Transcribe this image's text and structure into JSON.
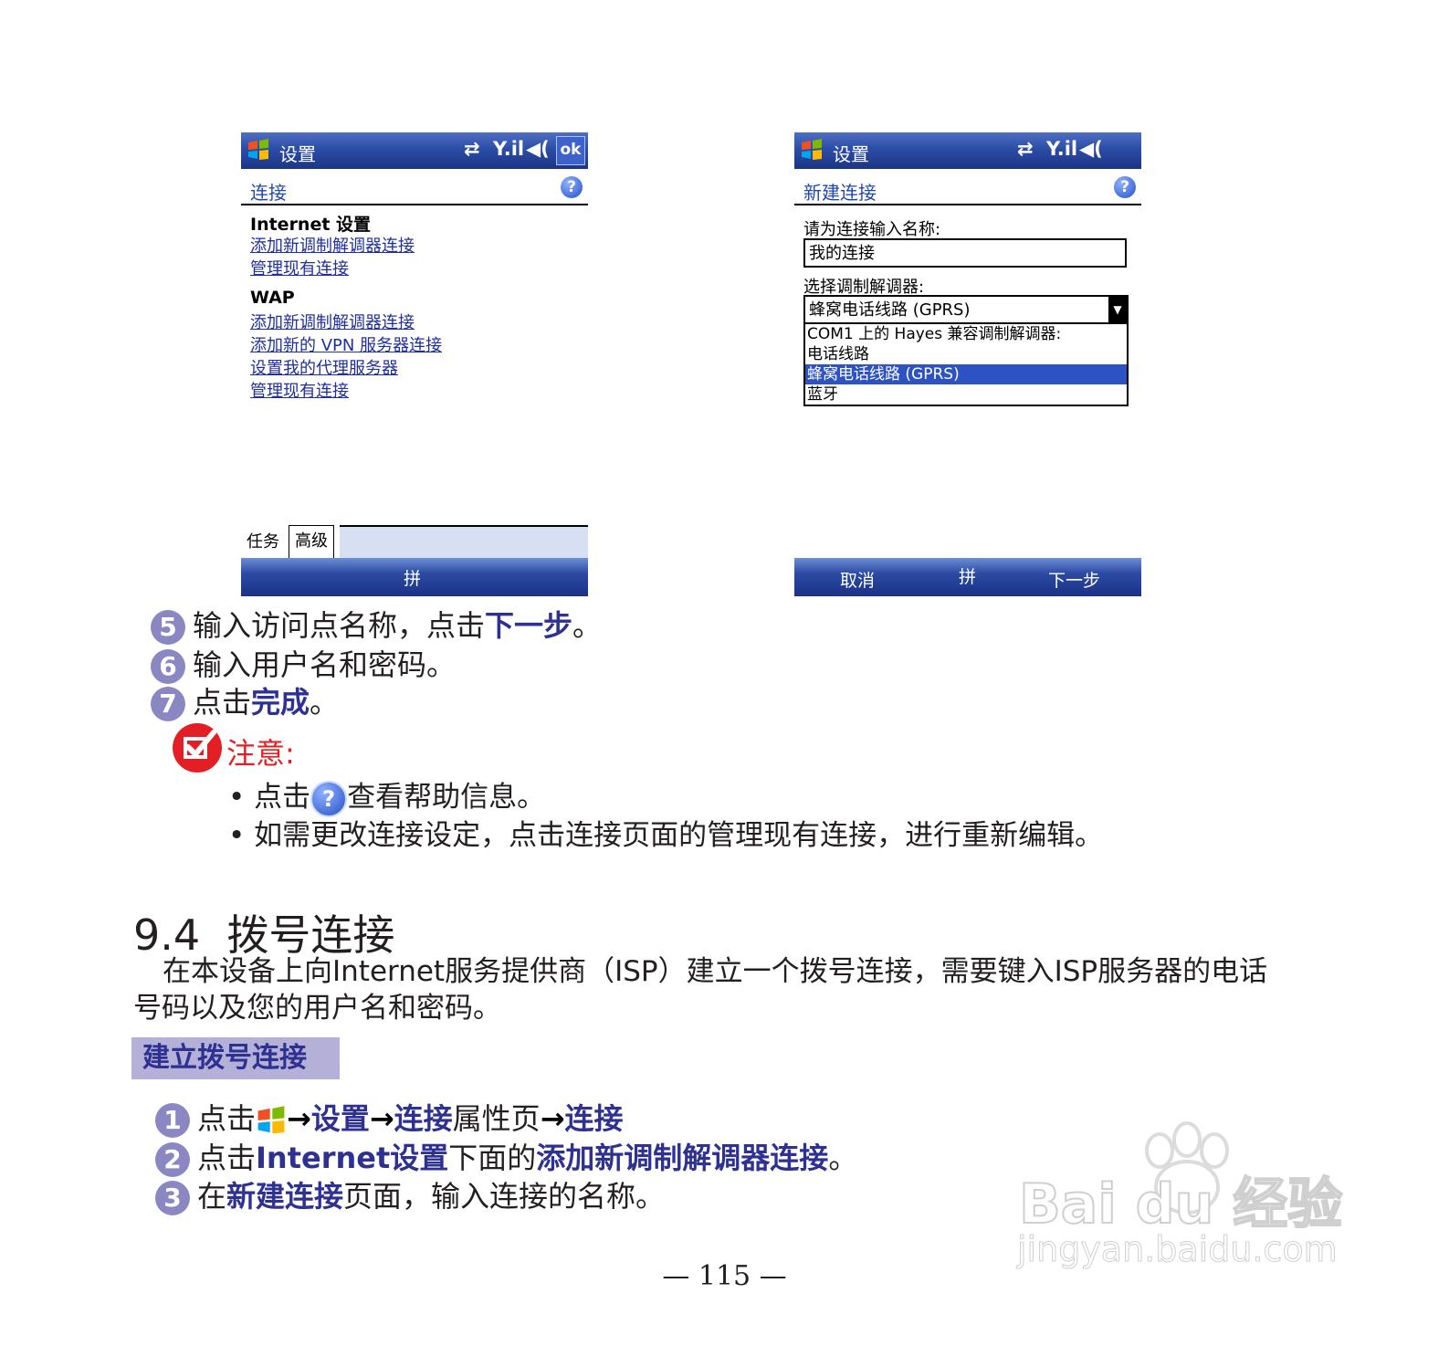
{
  "left_screen": {
    "title": "设置",
    "ok_label": "ok",
    "subheader": "连接",
    "help_glyph": "?",
    "sections": [
      {
        "heading": "Internet 设置",
        "links": [
          "添加新调制解调器连接",
          "管理现有连接"
        ]
      },
      {
        "heading": "WAP",
        "links": [
          "添加新调制解调器连接",
          "添加新的 VPN 服务器连接",
          "设置我的代理服务器",
          "管理现有连接"
        ]
      }
    ],
    "tabs": [
      "任务",
      "高级"
    ],
    "softbar_center": "拼"
  },
  "right_screen": {
    "title": "设置",
    "subheader": "新建连接",
    "help_glyph": "?",
    "name_label": "请为连接输入名称:",
    "name_value": "我的连接",
    "modem_label": "选择调制解调器:",
    "modem_selected": "蜂窝电话线路 (GPRS)",
    "modem_options": [
      "COM1 上的 Hayes 兼容调制解调器:",
      "电话线路",
      "蜂窝电话线路 (GPRS)",
      "蓝牙"
    ],
    "softbar": {
      "left": "取消",
      "center": "拼",
      "right": "下一步"
    }
  },
  "steps_top": [
    {
      "num": "5",
      "pre": "输入访问点名称，点击",
      "hl": "下一步",
      "post": "。"
    },
    {
      "num": "6",
      "pre": "输入用户名和密码。",
      "hl": "",
      "post": ""
    },
    {
      "num": "7",
      "pre": "点击",
      "hl": "完成",
      "post": "。"
    }
  ],
  "note": {
    "title": "注意:",
    "bullet1_pre": "点击",
    "bullet1_icon": "?",
    "bullet1_post": "查看帮助信息。",
    "bullet2": "如需更改连接设定，点击连接页面的管理现有连接，进行重新编辑。"
  },
  "section": {
    "number": "9.4",
    "title": "拨号连接",
    "paragraph": "在本设备上向Internet服务提供商（ISP）建立一个拨号连接，需要键入ISP服务器的电话号码以及您的用户名和密码。",
    "band_label": "建立拨号连接"
  },
  "steps_bottom": {
    "s1": {
      "num": "1",
      "pre": "点击",
      "a": "设置",
      "b": "连接",
      "mid": "属性页",
      "c": "连接",
      "arrow": "→"
    },
    "s2": {
      "num": "2",
      "pre": "点击",
      "a": "Internet设置",
      "mid": "下面的",
      "b": "添加新调制解调器连接",
      "post": "。"
    },
    "s3": {
      "num": "3",
      "pre": "在",
      "a": "新建连接",
      "post": "页面，输入连接的名称。"
    }
  },
  "page_number": "— 115 —",
  "watermark": {
    "brand": "Bai du 经验",
    "url": "jingyan.baidu.com"
  },
  "colors": {
    "title_blue": "#2c4da6",
    "highlight": "#2e3192",
    "band": "#b4b0d8",
    "note_red": "#e31e24",
    "step_circle": "#8b87c2"
  }
}
